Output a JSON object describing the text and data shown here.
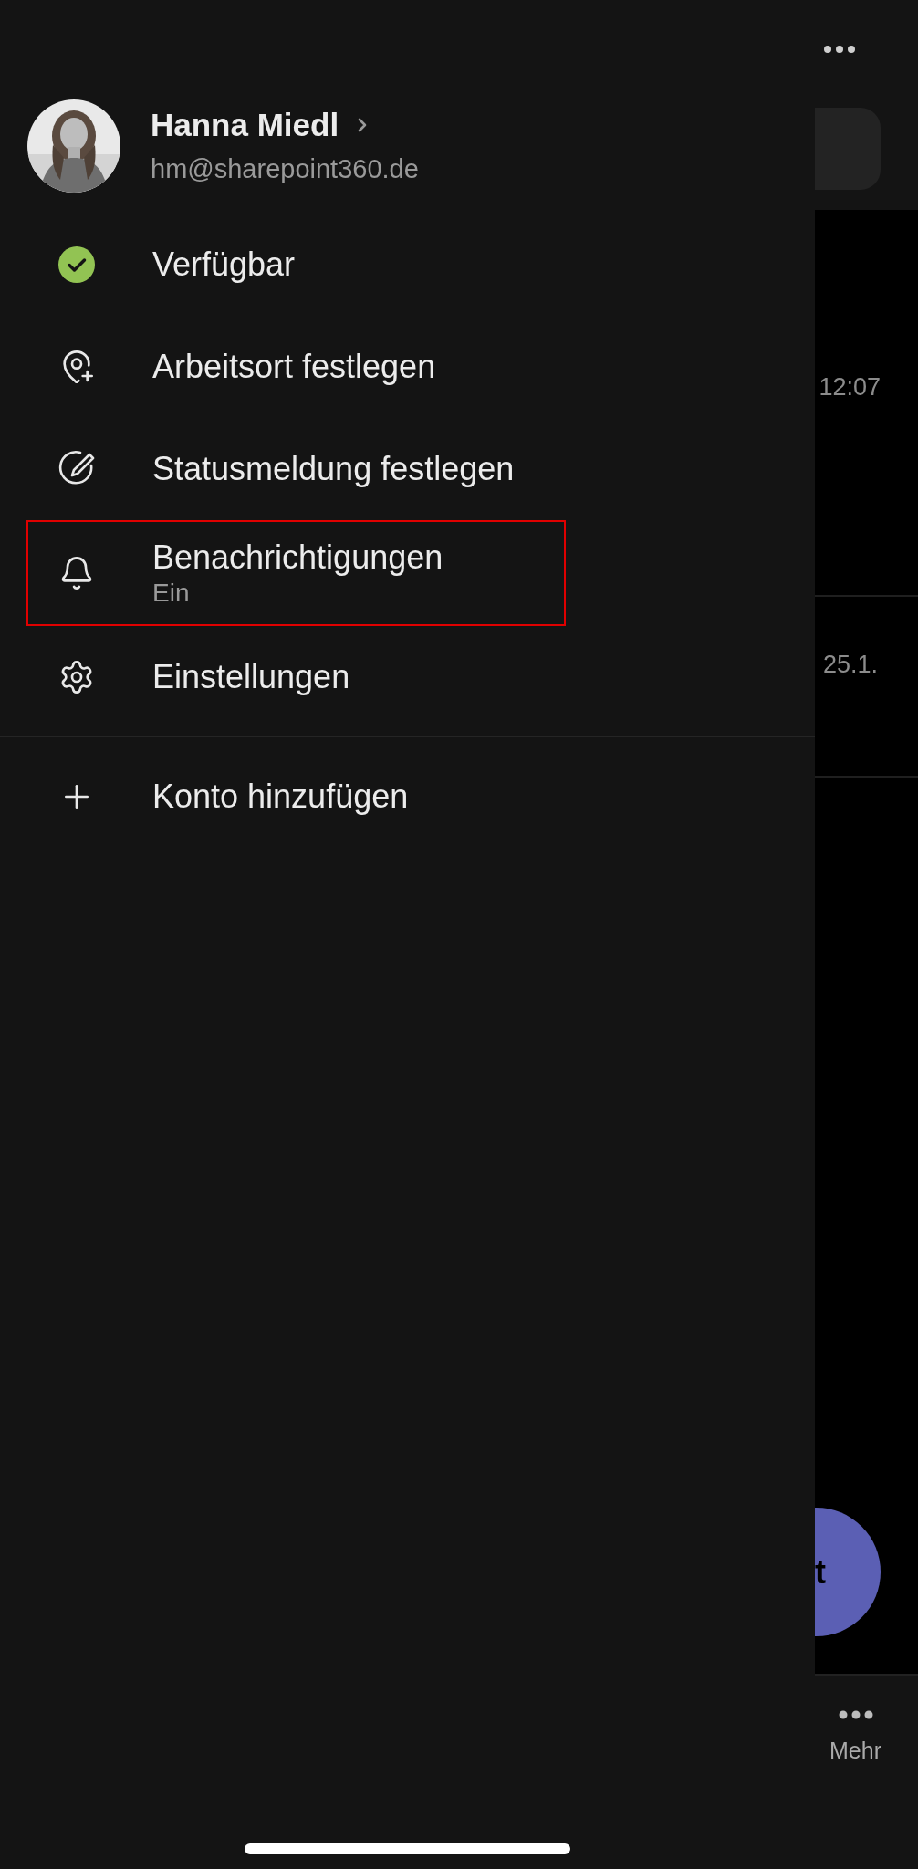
{
  "drawer": {
    "profile": {
      "name": "Hanna Miedl",
      "email": "hm@sharepoint360.de"
    },
    "items": [
      {
        "kind": "presence",
        "label": "Verfügbar",
        "highlighted": false
      },
      {
        "kind": "location",
        "label": "Arbeitsort festlegen",
        "highlighted": false
      },
      {
        "kind": "status-message",
        "label": "Statusmeldung festlegen",
        "highlighted": false
      },
      {
        "kind": "notifications",
        "label": "Benachrichtigungen",
        "sublabel": "Ein",
        "highlighted": true
      },
      {
        "kind": "settings",
        "label": "Einstellungen",
        "highlighted": false
      }
    ],
    "footer_items": [
      {
        "kind": "add",
        "label": "Konto hinzufügen"
      }
    ]
  },
  "background": {
    "timestamps": [
      "12:07",
      "25.1."
    ],
    "action_button": {
      "label": "t"
    },
    "nav": {
      "label": "Mehr"
    }
  }
}
